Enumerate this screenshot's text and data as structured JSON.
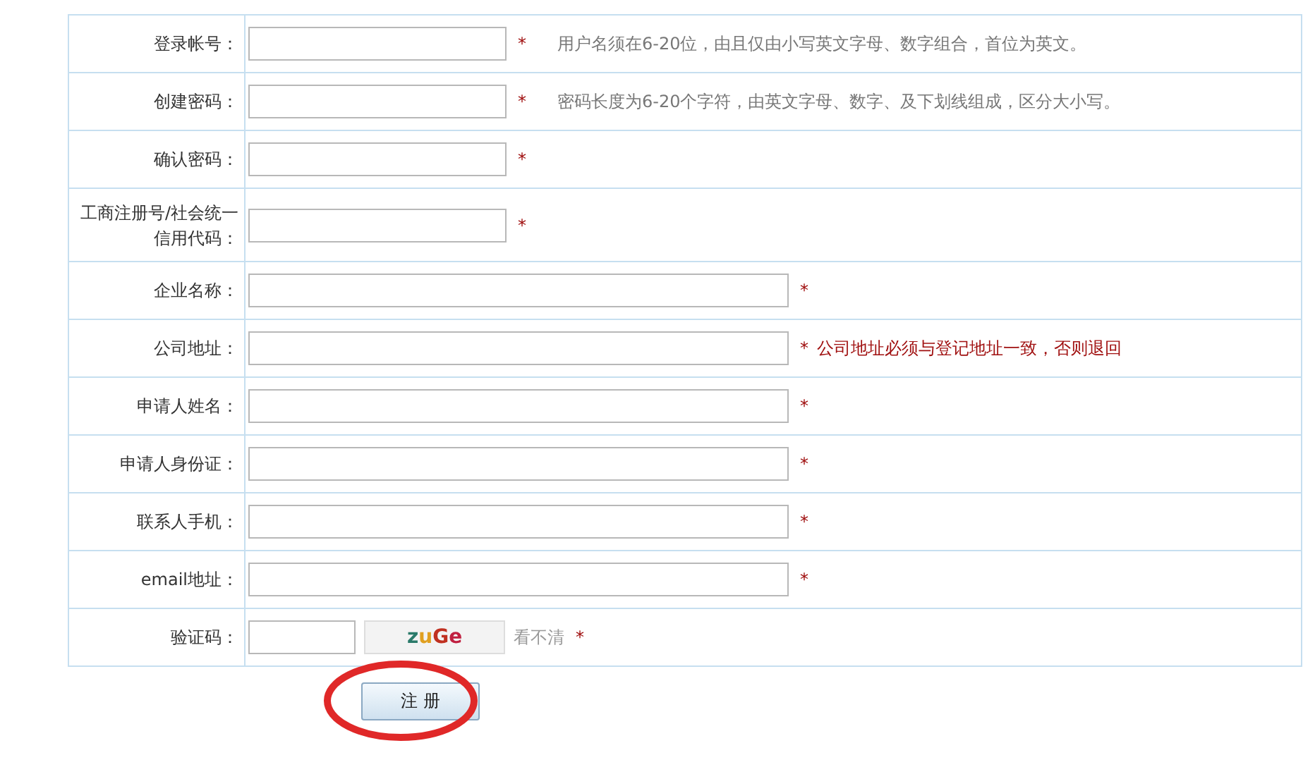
{
  "rows": [
    {
      "label": "登录帐号：",
      "kind": "short",
      "mark": "*",
      "hint": {
        "text": "用户名须在6-20位，由且仅由小写英文字母、数字组合，首位为英文。",
        "kind": "note"
      }
    },
    {
      "label": "创建密码：",
      "kind": "short",
      "mark": "*",
      "hint": {
        "text": "密码长度为6-20个字符，由英文字母、数字、及下划线组成，区分大小写。",
        "kind": "note"
      }
    },
    {
      "label": "确认密码：",
      "kind": "short",
      "mark": "*"
    },
    {
      "label": "工商注册号/社会统一信用代码：",
      "kind": "short",
      "mark": "*"
    },
    {
      "label": "企业名称：",
      "kind": "long",
      "mark": "*"
    },
    {
      "label": "公司地址：",
      "kind": "long",
      "mark": "*",
      "hint": {
        "text": "公司地址必须与登记地址一致，否则退回",
        "kind": "warning"
      }
    },
    {
      "label": "申请人姓名：",
      "kind": "long",
      "mark": "*"
    },
    {
      "label": "申请人身份证：",
      "kind": "long",
      "mark": "*"
    },
    {
      "label": "联系人手机：",
      "kind": "long",
      "mark": "*"
    },
    {
      "label": "email地址：",
      "kind": "long",
      "mark": "*"
    },
    {
      "label": "验证码：",
      "kind": "captcha",
      "mark": "*",
      "captcha": "zuGe",
      "refresh": "看不清"
    }
  ],
  "submit": {
    "label": "注 册",
    "circled": true
  }
}
